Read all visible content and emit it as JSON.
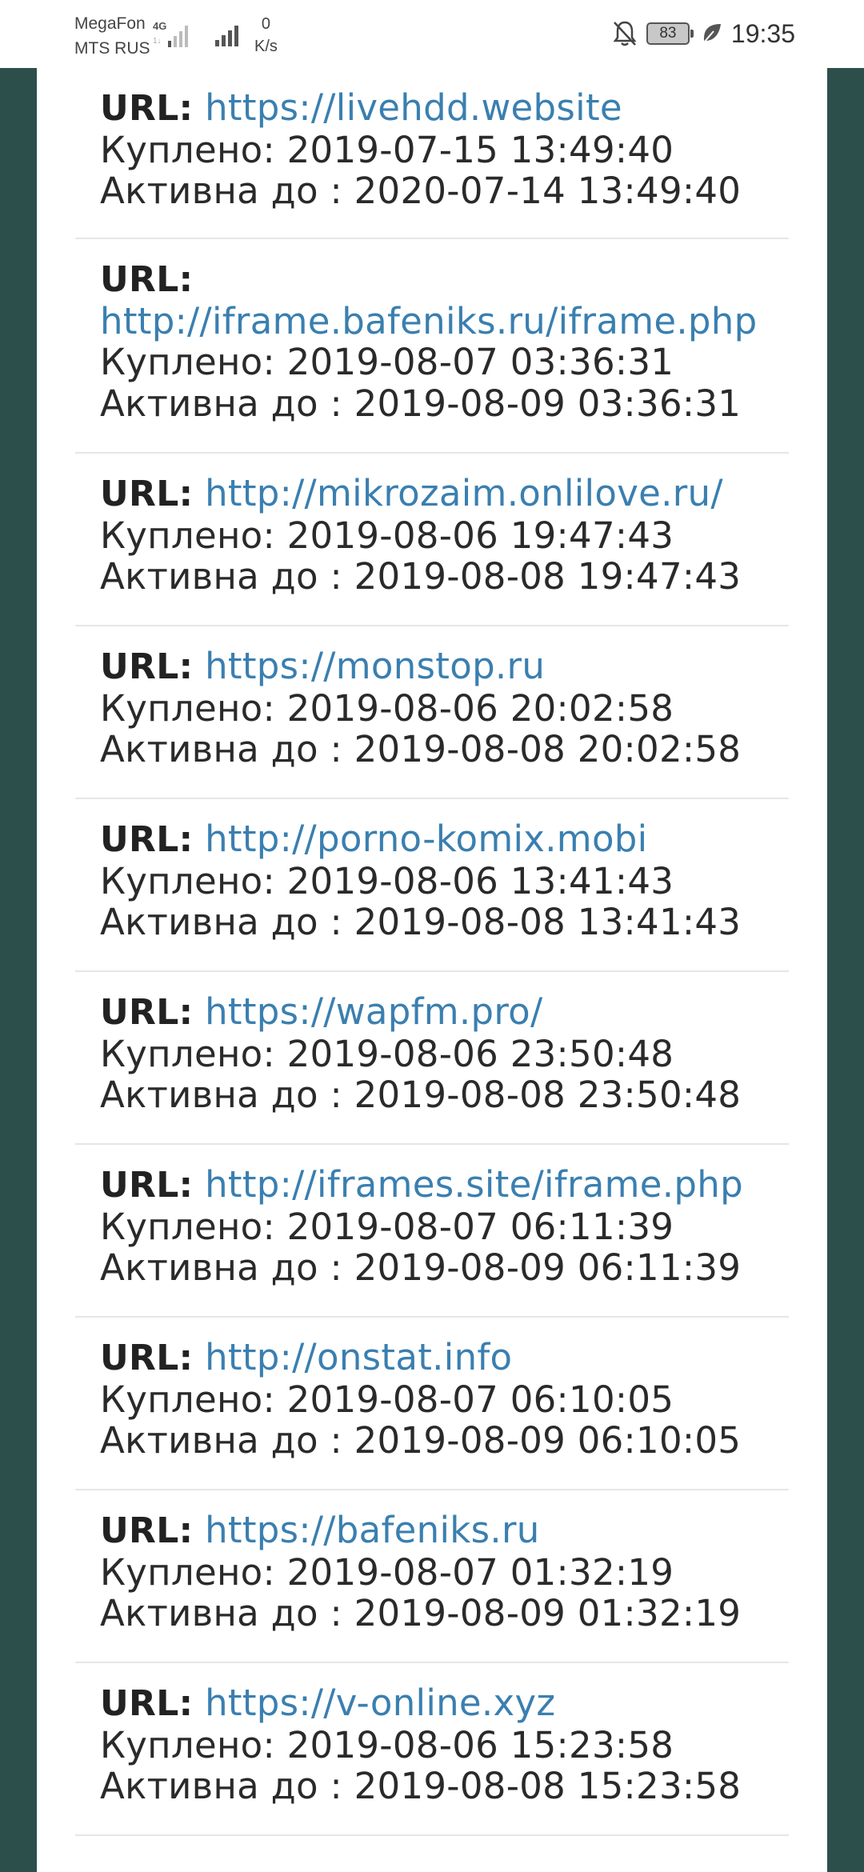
{
  "status_bar": {
    "carrier1": "MegaFon",
    "carrier2": "MTS RUS",
    "network_type": "4G",
    "speed_value": "0",
    "speed_unit": "K/s",
    "battery": "83",
    "time": "19:35"
  },
  "labels": {
    "url": "URL:",
    "bought": "Куплено:",
    "active_until": "Активна до :"
  },
  "entries": [
    {
      "url": "https://livehdd.website",
      "bought": "2019-07-15 13:49:40",
      "active_until": "2020-07-14 13:49:40"
    },
    {
      "url": "http://iframe.bafeniks.ru/iframe.php",
      "bought": "2019-08-07 03:36:31",
      "active_until": "2019-08-09 03:36:31"
    },
    {
      "url": "http://mikrozaim.onlilove.ru/",
      "bought": "2019-08-06 19:47:43",
      "active_until": "2019-08-08 19:47:43"
    },
    {
      "url": "https://monstop.ru",
      "bought": "2019-08-06 20:02:58",
      "active_until": "2019-08-08 20:02:58"
    },
    {
      "url": "http://porno-komix.mobi",
      "bought": "2019-08-06 13:41:43",
      "active_until": "2019-08-08 13:41:43"
    },
    {
      "url": "https://wapfm.pro/",
      "bought": "2019-08-06 23:50:48",
      "active_until": "2019-08-08 23:50:48"
    },
    {
      "url": "http://iframes.site/iframe.php",
      "bought": "2019-08-07 06:11:39",
      "active_until": "2019-08-09 06:11:39"
    },
    {
      "url": "http://onstat.info",
      "bought": "2019-08-07 06:10:05",
      "active_until": "2019-08-09 06:10:05"
    },
    {
      "url": "https://bafeniks.ru",
      "bought": "2019-08-07 01:32:19",
      "active_until": "2019-08-09 01:32:19"
    },
    {
      "url": "https://v-online.xyz",
      "bought": "2019-08-06 15:23:58",
      "active_until": "2019-08-08 15:23:58"
    }
  ]
}
